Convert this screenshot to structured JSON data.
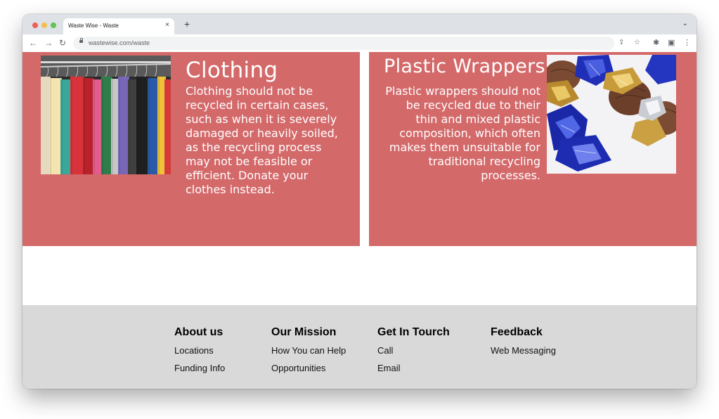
{
  "browser": {
    "tab_title": "Waste Wise - Waste",
    "tab_close": "×",
    "new_tab": "+",
    "tabs_menu": "⌄",
    "back": "←",
    "forward": "→",
    "reload": "↻",
    "url": "wastewise.com/waste",
    "share": "⇪",
    "star": "☆",
    "extensions": "✱",
    "sidepanel": "▣",
    "menu": "⋮"
  },
  "cards": [
    {
      "title": "Clothing",
      "text": "Clothing should not be recycled in certain cases, such as when it is severely damaged or heavily soiled, as the recycling process may not be feasible or efficient. Donate your clothes instead.",
      "image": "clothing-rack-photo"
    },
    {
      "title": "Plastic Wrappers",
      "text": "Plastic wrappers should not be recycled due to their thin and mixed plastic composition, which often makes them unsuitable for traditional recycling processes.",
      "image": "candy-wrappers-photo"
    }
  ],
  "footer": {
    "columns": [
      {
        "heading": "About us",
        "links": [
          "Locations",
          "Funding Info"
        ]
      },
      {
        "heading": "Our Mission",
        "links": [
          "How You can Help",
          "Opportunities"
        ]
      },
      {
        "heading": "Get In Tourch",
        "links": [
          "Call",
          "Email"
        ]
      },
      {
        "heading": "Feedback",
        "links": [
          "Web Messaging"
        ]
      }
    ]
  },
  "colors": {
    "card_bg": "#d4696a",
    "footer_bg": "#d9d9d9",
    "tabstrip_bg": "#dee1e6"
  }
}
